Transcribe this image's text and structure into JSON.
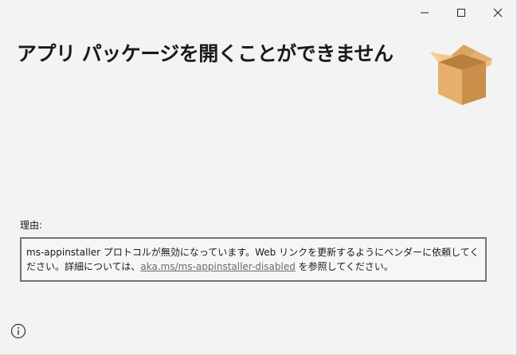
{
  "window": {
    "title": "アプリ パッケージを開くことができません",
    "icons": {
      "minimize": "minimize-icon",
      "maximize": "maximize-icon",
      "close": "close-icon",
      "package": "package-box-icon",
      "info": "info-icon"
    }
  },
  "reason": {
    "label": "理由:",
    "text_before": "ms-appinstaller プロトコルが無効になっています。Web リンクを更新するようにベンダーに依頼してください。詳細については、",
    "link": "aka.ms/ms-appinstaller-disabled",
    "text_after": " を参照してください。"
  },
  "colors": {
    "background": "#f3f3f3",
    "box_border": "#737373",
    "link": "#6b6b6b",
    "box_light": "#e8b977",
    "box_dark": "#c98f4b"
  }
}
